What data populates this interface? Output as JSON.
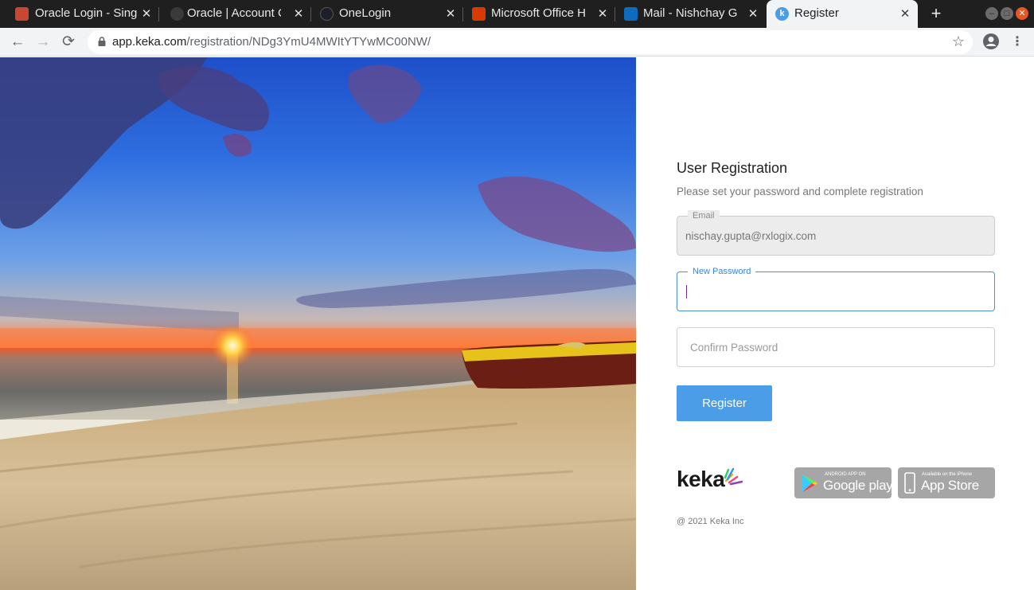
{
  "browser": {
    "tabs": [
      {
        "title": "Oracle Login - Sing",
        "favicon": "oracle-icon",
        "color": "#c74634",
        "active": false
      },
      {
        "title": "Oracle | Account C",
        "favicon": "oracle-account-icon",
        "color": "#3a3a3a",
        "active": false
      },
      {
        "title": "OneLogin",
        "favicon": "onelogin-icon",
        "color": "#1c1f2a",
        "active": false
      },
      {
        "title": "Microsoft Office H",
        "favicon": "office-icon",
        "color": "#d83b01",
        "active": false
      },
      {
        "title": "Mail - Nishchay Gu",
        "favicon": "outlook-icon",
        "color": "#0f6cbd",
        "active": false
      },
      {
        "title": "Register",
        "favicon": "keka-icon",
        "color": "#4a9de6",
        "active": true
      }
    ],
    "url_host": "app.keka.com",
    "url_path": "/registration/NDg3YmU4MWItYTYwMC00NW/"
  },
  "form": {
    "heading": "User Registration",
    "subheading": "Please set your password and complete registration",
    "email_label": "Email",
    "email_value": "nischay.gupta@rxlogix.com",
    "new_password_label": "New Password",
    "new_password_value": "",
    "confirm_password_placeholder": "Confirm Password",
    "register_label": "Register"
  },
  "footer": {
    "logo_text": "keka",
    "google_play_small": "ANDROID APP ON",
    "google_play_big": "Google play",
    "app_store_small": "Available on the iPhone",
    "app_store_big": "App Store",
    "copyright": "@ 2021 Keka Inc"
  },
  "colors": {
    "accent": "#4a9de6",
    "focus_border": "#4a90d9",
    "store_badge": "#a6a6a6"
  }
}
